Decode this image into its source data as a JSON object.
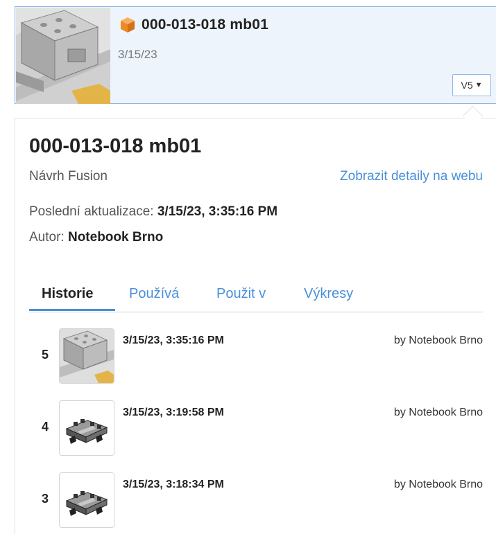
{
  "card": {
    "title": "000-013-018 mb01",
    "date": "3/15/23",
    "version_label": "V5",
    "icon": "cube-icon"
  },
  "details": {
    "title": "000-013-018 mb01",
    "type": "Návrh Fusion",
    "web_link": "Zobrazit detaily na webu",
    "updated_label": "Poslední aktualizace:",
    "updated_value": "3/15/23, 3:35:16 PM",
    "author_label": "Autor:",
    "author_value": "Notebook Brno"
  },
  "tabs": [
    {
      "label": "Historie"
    },
    {
      "label": "Používá"
    },
    {
      "label": "Použit v"
    },
    {
      "label": "Výkresy"
    }
  ],
  "active_tab": "Historie",
  "history": [
    {
      "version": "5",
      "date": "3/15/23, 3:35:16 PM",
      "author": "by Notebook Brno"
    },
    {
      "version": "4",
      "date": "3/15/23, 3:19:58 PM",
      "author": "by Notebook Brno"
    },
    {
      "version": "3",
      "date": "3/15/23, 3:18:34 PM",
      "author": "by Notebook Brno"
    }
  ],
  "colors": {
    "accent": "#4a90d9",
    "card_border": "#8db6e8",
    "card_bg": "#eef4fc",
    "cube_orange": "#f08a24"
  }
}
